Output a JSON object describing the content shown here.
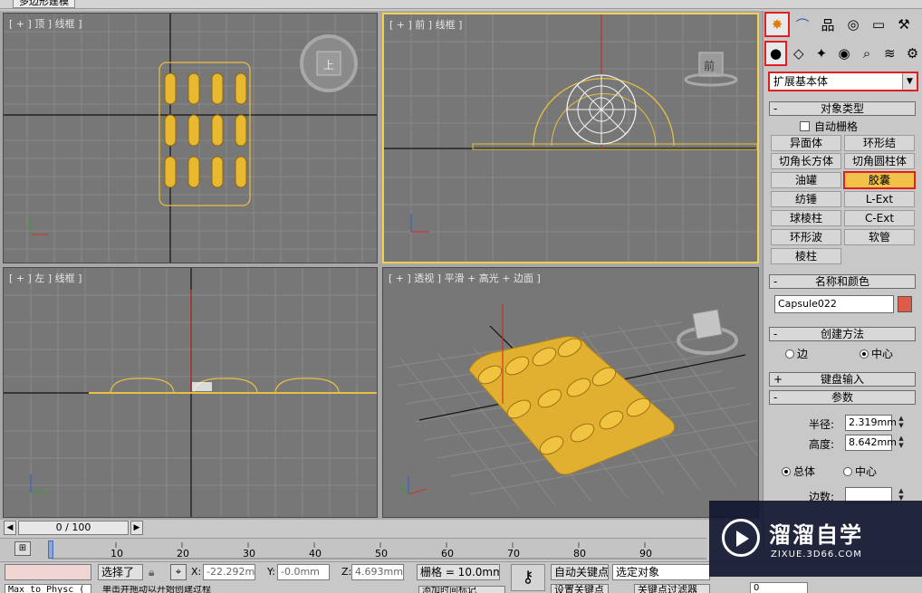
{
  "window_tab": "多边形建模",
  "viewports": {
    "top": "[ + ] 顶 ] 线框 ]",
    "front": "[ + ] 前 ] 线框 ]",
    "left": "[ + ] 左 ] 线框 ]",
    "persp": "[ + ] 透视 ] 平滑 + 高光 + 边面 ]",
    "cube_top": "上",
    "cube_front": "前"
  },
  "command_panel": {
    "category_dropdown": "扩展基本体",
    "object_type_title": "对象类型",
    "auto_grid": "自动栅格",
    "object_buttons": [
      "异面体",
      "环形结",
      "切角长方体",
      "切角圆柱体",
      "油罐",
      "胶囊",
      "纺锤",
      "L-Ext",
      "球棱柱",
      "C-Ext",
      "环形波",
      "软管",
      "棱柱"
    ],
    "active_button": "胶囊",
    "name_color_title": "名称和颜色",
    "object_name": "Capsule022",
    "object_color": "#e05a4a",
    "creation_method_title": "创建方法",
    "creation_edge": "边",
    "creation_center": "中心",
    "keyboard_title": "键盘输入",
    "params_title": "参数",
    "radius_label": "半径:",
    "radius_value": "2.319mm",
    "height_label": "高度:",
    "height_value": "8.642mm",
    "overall": "总体",
    "center": "中心",
    "sides_label": "边数:"
  },
  "timeline": {
    "frame_display": "0 / 100",
    "ticks": [
      "10",
      "20",
      "30",
      "40",
      "50",
      "60",
      "70",
      "80",
      "90"
    ]
  },
  "status_bar": {
    "maxscript": "Max to Physc (",
    "selected": "选择了",
    "x_label": "X:",
    "x_value": "-22.292mm",
    "y_label": "Y:",
    "y_value": "-0.0mm",
    "z_label": "Z:",
    "z_value": "4.693mm",
    "grid": "栅格 = 10.0mm",
    "auto_key": "自动关键点",
    "selected_objects": "选定对象",
    "set_key": "设置关键点",
    "key_filters": "关键点过滤器",
    "prompt": "单击并拖动以开始创建过程",
    "add_time_tag": "添加时间标记",
    "frame_value": "0"
  },
  "watermark": {
    "title": "溜溜自学",
    "url": "ZIXUE.3D66.COM"
  }
}
